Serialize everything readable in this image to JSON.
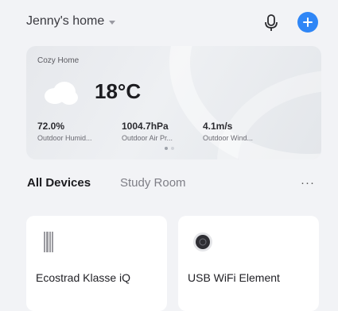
{
  "header": {
    "home_name": "Jenny's home",
    "mic_icon": "microphone-icon",
    "add_icon": "plus-circle-icon",
    "accent_color": "#2f86f6"
  },
  "weather": {
    "location_label": "Cozy Home",
    "condition_icon": "cloud-icon",
    "temperature": "18°C",
    "humidity": {
      "value": "72.0%",
      "label": "Outdoor Humid..."
    },
    "air_pressure": {
      "value": "1004.7hPa",
      "label": "Outdoor Air Pr..."
    },
    "wind": {
      "value": "4.1m/s",
      "label": "Outdoor Wind..."
    },
    "pager": {
      "pages": 2,
      "active": 1
    }
  },
  "tabs": {
    "items": [
      {
        "label": "All Devices",
        "active": true
      },
      {
        "label": "Study Room",
        "active": false
      }
    ],
    "more": "···"
  },
  "devices": [
    {
      "name": "Ecostrad Klasse iQ",
      "icon": "radiator-icon"
    },
    {
      "name": "USB WiFi Element",
      "icon": "thermostat-icon"
    }
  ]
}
